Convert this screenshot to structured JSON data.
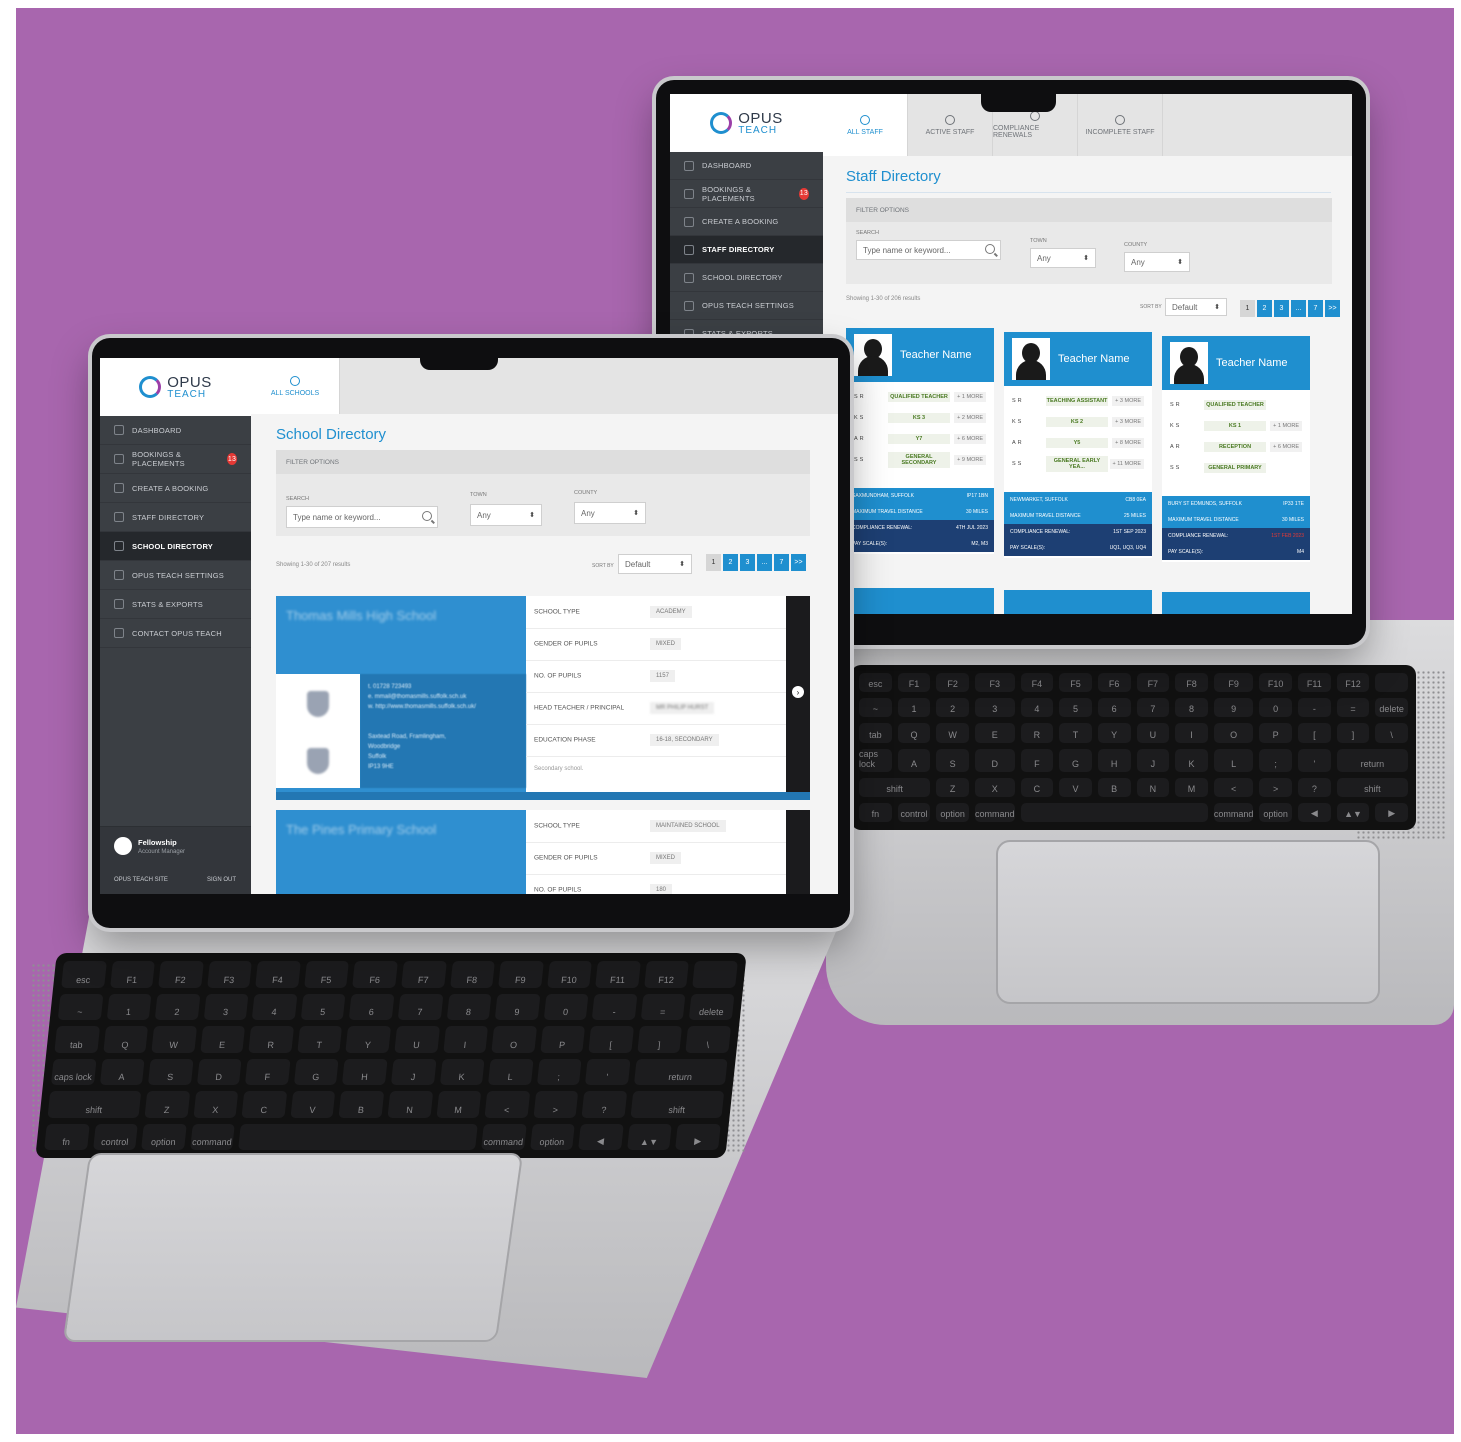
{
  "brand": {
    "opus": "OPUS",
    "teach": "TEACH",
    "accent": "#1f8fcf",
    "background": "#a866ae"
  },
  "schools_app": {
    "nav": [
      {
        "label": "DASHBOARD"
      },
      {
        "label": "BOOKINGS & PLACEMENTS",
        "badge": "13"
      },
      {
        "label": "CREATE A BOOKING"
      },
      {
        "label": "STAFF DIRECTORY"
      },
      {
        "label": "SCHOOL DIRECTORY",
        "active": true
      },
      {
        "label": "OPUS TEACH SETTINGS"
      },
      {
        "label": "STATS & EXPORTS"
      },
      {
        "label": "CONTACT OPUS TEACH"
      }
    ],
    "user": {
      "name": "Fellowship",
      "role": "Account Manager",
      "site_link": "OPUS TEACH SITE",
      "sign_out": "SIGN OUT"
    },
    "tabs": [
      {
        "label": "ALL SCHOOLS"
      }
    ],
    "title": "School Directory",
    "filter": {
      "heading": "FILTER OPTIONS",
      "search_label": "SEARCH",
      "search_placeholder": "Type name or keyword...",
      "town_label": "TOWN",
      "town_value": "Any",
      "county_label": "COUNTY",
      "county_value": "Any"
    },
    "results": "Showing 1-30 of 207 results",
    "sort_label": "SORT BY",
    "sort_value": "Default",
    "pages": [
      "1",
      "2",
      "3",
      "...",
      "7",
      ">>"
    ],
    "schools": [
      {
        "name": "Thomas Mills High School",
        "phone": "t. 01728 723493",
        "email": "e. mmail@thomasmills.suffolk.sch.uk",
        "web": "w. http://www.thomasmills.suffolk.sch.uk/",
        "address": [
          "Saxtead Road, Framlingham,",
          "Woodbridge",
          "Suffolk",
          "IP13 9HE"
        ],
        "rows": [
          {
            "label": "SCHOOL TYPE",
            "value": "ACADEMY"
          },
          {
            "label": "GENDER OF PUPILS",
            "value": "MIXED"
          },
          {
            "label": "NO. OF PUPILS",
            "value": "1157"
          },
          {
            "label": "HEAD TEACHER / PRINCIPAL",
            "value": "MR PHILIP HURST"
          },
          {
            "label": "EDUCATION PHASE",
            "value": "16-18, SECONDARY"
          }
        ],
        "note": "Secondary school."
      },
      {
        "name": "The Pines Primary School",
        "rows": [
          {
            "label": "SCHOOL TYPE",
            "value": "MAINTAINED SCHOOL"
          },
          {
            "label": "GENDER OF PUPILS",
            "value": "MIXED"
          },
          {
            "label": "NO. OF PUPILS",
            "value": "180"
          }
        ]
      }
    ]
  },
  "staff_app": {
    "nav": [
      {
        "label": "DASHBOARD"
      },
      {
        "label": "BOOKINGS & PLACEMENTS",
        "badge": "13"
      },
      {
        "label": "CREATE A BOOKING"
      },
      {
        "label": "STAFF DIRECTORY",
        "active": true
      },
      {
        "label": "SCHOOL DIRECTORY"
      },
      {
        "label": "OPUS TEACH SETTINGS"
      },
      {
        "label": "STATS & EXPORTS"
      }
    ],
    "tabs": [
      {
        "label": "ALL STAFF"
      },
      {
        "label": "ACTIVE STAFF"
      },
      {
        "label": "COMPLIANCE RENEWALS"
      },
      {
        "label": "INCOMPLETE STAFF"
      }
    ],
    "title": "Staff Directory",
    "filter": {
      "heading": "FILTER OPTIONS",
      "search_label": "SEARCH",
      "search_placeholder": "Type name or keyword...",
      "town_label": "TOWN",
      "town_value": "Any",
      "county_label": "COUNTY",
      "county_value": "Any"
    },
    "results": "Showing 1-30 of 206 results",
    "sort_label": "SORT BY",
    "sort_value": "Default",
    "pages": [
      "1",
      "2",
      "3",
      "...",
      "7",
      ">>"
    ],
    "cards": [
      {
        "name": "Teacher Name",
        "rows": [
          {
            "k": "SR",
            "tag": "QUALIFIED TEACHER",
            "more": "+ 1 MORE"
          },
          {
            "k": "KS",
            "tag": "KS 3",
            "more": "+ 2 MORE"
          },
          {
            "k": "AR",
            "tag": "Y7",
            "more": "+ 6 MORE"
          },
          {
            "k": "SS",
            "tag": "GENERAL SECONDARY",
            "more": "+ 9 MORE"
          }
        ],
        "location": "SAXMUNDHAM, SUFFOLK",
        "postcode": "IP17 1BN",
        "travel_label": "MAXIMUM TRAVEL DISTANCE",
        "travel": "30 MILES",
        "compliance_label": "COMPLIANCE RENEWAL:",
        "compliance": "4TH JUL 2023",
        "pay_label": "PAY SCALE(S):",
        "pay": "M2, M3"
      },
      {
        "name": "Teacher Name",
        "rows": [
          {
            "k": "SR",
            "tag": "TEACHING ASSISTANT",
            "more": "+ 3 MORE"
          },
          {
            "k": "KS",
            "tag": "KS 2",
            "more": "+ 3 MORE"
          },
          {
            "k": "AR",
            "tag": "Y5",
            "more": "+ 8 MORE"
          },
          {
            "k": "SS",
            "tag": "GENERAL EARLY YEA...",
            "more": "+ 11 MORE"
          }
        ],
        "location": "NEWMARKET, SUFFOLK",
        "postcode": "CB8 0EA",
        "travel_label": "MAXIMUM TRAVEL DISTANCE",
        "travel": "25 MILES",
        "compliance_label": "COMPLIANCE RENEWAL:",
        "compliance": "1ST SEP 2023",
        "pay_label": "PAY SCALE(S):",
        "pay": "UQ1, UQ3, UQ4"
      },
      {
        "name": "Teacher Name",
        "rows": [
          {
            "k": "SR",
            "tag": "QUALIFIED TEACHER",
            "more": ""
          },
          {
            "k": "KS",
            "tag": "KS 1",
            "more": "+ 1 MORE"
          },
          {
            "k": "AR",
            "tag": "RECEPTION",
            "more": "+ 6 MORE"
          },
          {
            "k": "SS",
            "tag": "GENERAL PRIMARY",
            "more": ""
          }
        ],
        "location": "BURY ST EDMUNDS, SUFFOLK",
        "postcode": "IP33 1TE",
        "travel_label": "MAXIMUM TRAVEL DISTANCE",
        "travel": "30 MILES",
        "compliance_label": "COMPLIANCE RENEWAL:",
        "compliance": "1ST FEB 2023",
        "compliance_color": "#e53935",
        "pay_label": "PAY SCALE(S):",
        "pay": "M4"
      }
    ]
  },
  "keyboard": {
    "row1": [
      "esc",
      "F1",
      "F2",
      "F3",
      "F4",
      "F5",
      "F6",
      "F7",
      "F8",
      "F9",
      "F10",
      "F11",
      "F12",
      ""
    ],
    "row2": [
      "~",
      "1",
      "2",
      "3",
      "4",
      "5",
      "6",
      "7",
      "8",
      "9",
      "0",
      "-",
      "=",
      "delete"
    ],
    "row3": [
      "tab",
      "Q",
      "W",
      "E",
      "R",
      "T",
      "Y",
      "U",
      "I",
      "O",
      "P",
      "[",
      "]",
      "\\"
    ],
    "row4": [
      "caps lock",
      "A",
      "S",
      "D",
      "F",
      "G",
      "H",
      "J",
      "K",
      "L",
      ";",
      "'",
      "return"
    ],
    "row5": [
      "shift",
      "Z",
      "X",
      "C",
      "V",
      "B",
      "N",
      "M",
      "<",
      ">",
      "?",
      "shift"
    ],
    "row6": [
      "fn",
      "control",
      "option",
      "command",
      "",
      "command",
      "option",
      "◀",
      "▲▼",
      "▶"
    ]
  }
}
